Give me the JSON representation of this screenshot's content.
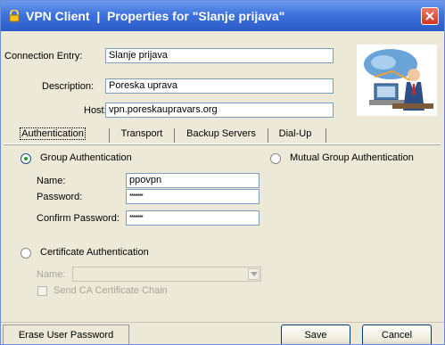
{
  "window": {
    "title": "VPN Client  |  Properties for \"Slanje prijava\"",
    "icons": {
      "app": "vpn-lock-icon",
      "close": "close-icon",
      "logo": "vpn-illustration-icon"
    },
    "colors": {
      "titlebar": "#3e72dc",
      "close": "#d3331b",
      "face": "#ece9d8"
    }
  },
  "fields": {
    "connection_entry": {
      "label": "Connection Entry:",
      "value": "Slanje prijava"
    },
    "description": {
      "label": "Description:",
      "value": "Poreska uprava"
    },
    "host": {
      "label": "Host:",
      "value": "vpn.poreskaupravars.org"
    }
  },
  "tabs": [
    {
      "label": "Authentication",
      "active": true
    },
    {
      "label": "Transport",
      "active": false
    },
    {
      "label": "Backup Servers",
      "active": false
    },
    {
      "label": "Dial-Up",
      "active": false
    }
  ],
  "auth": {
    "group_auth_label": "Group Authentication",
    "group_auth_selected": true,
    "mutual_auth_label": "Mutual Group Authentication",
    "mutual_auth_selected": false,
    "name_label": "Name:",
    "name_value": "ppovpn",
    "password_label": "Password:",
    "password_value": "*******",
    "confirm_label": "Confirm Password:",
    "confirm_value": "*******",
    "cert_auth_label": "Certificate Authentication",
    "cert_auth_selected": false,
    "cert_name_label": "Name:",
    "cert_name_value": "",
    "send_ca_label": "Send CA Certificate Chain",
    "send_ca_checked": false
  },
  "buttons": {
    "erase": "Erase User Password",
    "save": "Save",
    "cancel": "Cancel"
  }
}
